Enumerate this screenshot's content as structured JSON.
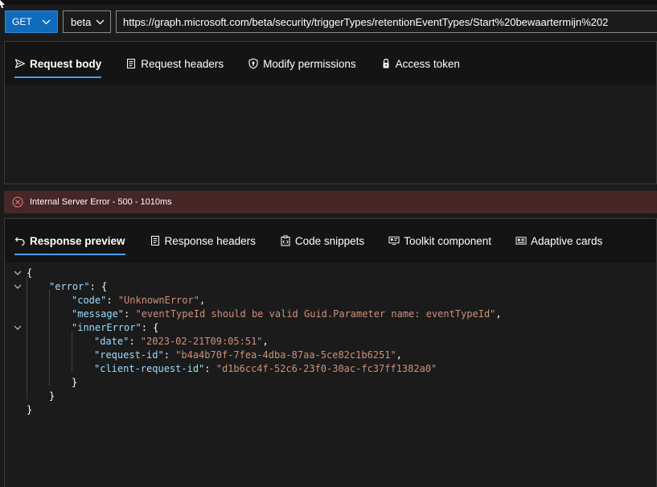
{
  "request": {
    "method": "GET",
    "version": "beta",
    "url": "https://graph.microsoft.com/beta/security/triggerTypes/retentionEventTypes/Start%20bewaartermijn%202"
  },
  "request_tabs": [
    {
      "label": "Request body",
      "icon": "send-icon",
      "active": true
    },
    {
      "label": "Request headers",
      "icon": "document-icon",
      "active": false
    },
    {
      "label": "Modify permissions",
      "icon": "shield-key-icon",
      "active": false
    },
    {
      "label": "Access token",
      "icon": "lock-icon",
      "active": false
    }
  ],
  "status": {
    "text": "Internal Server Error - 500 - 1010ms",
    "color": "#442726"
  },
  "response_tabs": [
    {
      "label": "Response preview",
      "icon": "undo-arrow-icon",
      "active": true
    },
    {
      "label": "Response headers",
      "icon": "document-icon",
      "active": false
    },
    {
      "label": "Code snippets",
      "icon": "code-clipboard-icon",
      "active": false
    },
    {
      "label": "Toolkit component",
      "icon": "toolkit-icon",
      "active": false
    },
    {
      "label": "Adaptive cards",
      "icon": "card-icon",
      "active": false
    }
  ],
  "response": {
    "open_brace": "{",
    "close_brace": "}",
    "error_key": "\"error\"",
    "code_key": "\"code\"",
    "code_value": "\"UnknownError\"",
    "message_key": "\"message\"",
    "message_value": "\"eventTypeId should be valid Guid.Parameter name: eventTypeId\"",
    "inner_error_key": "\"innerError\"",
    "date_key": "\"date\"",
    "date_value": "\"2023-02-21T09:05:51\"",
    "request_id_key": "\"request-id\"",
    "request_id_value": "\"b4a4b70f-7fea-4dba-87aa-5ce82c1b6251\"",
    "client_request_id_key": "\"client-request-id\"",
    "client_request_id_value": "\"d1b6cc4f-52c6-23f0-30ac-fc37ff1382a0\""
  },
  "colors": {
    "accent": "#0f6cbd",
    "tab_underline": "#479ef5",
    "json_key": "#9cdcfe",
    "json_string": "#ce9178"
  }
}
